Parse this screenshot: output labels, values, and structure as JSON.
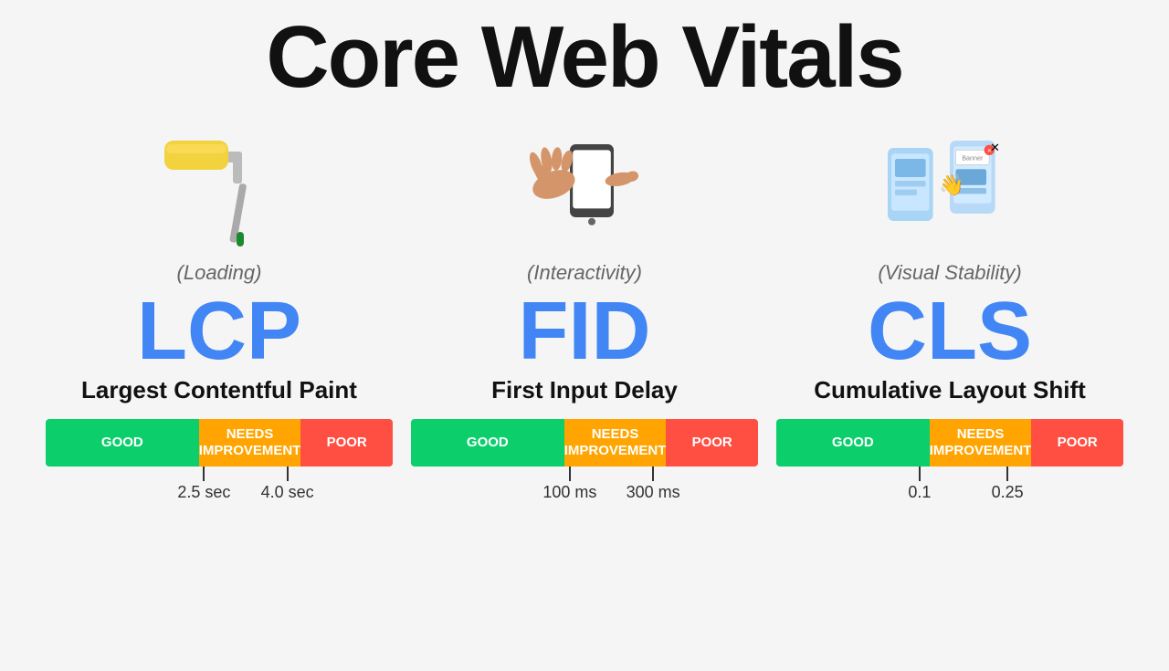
{
  "title": "Core Web Vitals",
  "vitals": [
    {
      "id": "lcp",
      "category": "(Loading)",
      "acronym": "LCP",
      "name": "Largest Contentful Paint",
      "icon": "paint-roller",
      "bar": {
        "good": "GOOD",
        "needs": "NEEDS IMPROVEMENT",
        "poor": "POOR"
      },
      "markers": [
        {
          "label": "2.5 sec",
          "position": "38%"
        },
        {
          "label": "4.0 sec",
          "position": "62%"
        }
      ]
    },
    {
      "id": "fid",
      "category": "(Interactivity)",
      "acronym": "FID",
      "name": "First Input Delay",
      "icon": "phone-touch",
      "bar": {
        "good": "GOOD",
        "needs": "NEEDS IMPROVEMENT",
        "poor": "POOR"
      },
      "markers": [
        {
          "label": "100 ms",
          "position": "38%"
        },
        {
          "label": "300 ms",
          "position": "62%"
        }
      ]
    },
    {
      "id": "cls",
      "category": "(Visual Stability)",
      "acronym": "CLS",
      "name": "Cumulative Layout Shift",
      "icon": "layout-shift",
      "bar": {
        "good": "GOOD",
        "needs": "NEEDS IMPROVEMENT",
        "poor": "POOR"
      },
      "markers": [
        {
          "label": "0.1",
          "position": "38%"
        },
        {
          "label": "0.25",
          "position": "62%"
        }
      ]
    }
  ],
  "colors": {
    "good": "#0cce6b",
    "needs": "#ffa400",
    "poor": "#ff4e42",
    "acronym": "#4285f4"
  }
}
